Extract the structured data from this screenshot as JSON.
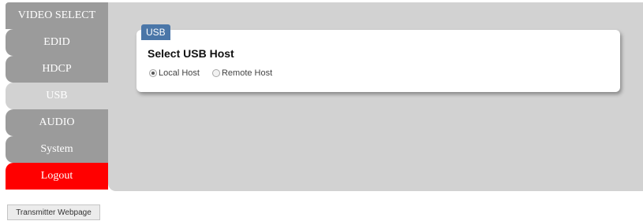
{
  "sidebar": {
    "items": [
      {
        "label": "VIDEO SELECT",
        "active": false
      },
      {
        "label": "EDID",
        "active": false
      },
      {
        "label": "HDCP",
        "active": false
      },
      {
        "label": "USB",
        "active": true
      },
      {
        "label": "AUDIO",
        "active": false
      },
      {
        "label": "System",
        "active": false
      }
    ],
    "logout_label": "Logout"
  },
  "panel": {
    "tag": "USB",
    "title": "Select USB Host",
    "options": [
      {
        "label": "Local Host",
        "checked": true
      },
      {
        "label": "Remote Host",
        "checked": false
      }
    ]
  },
  "footer": {
    "button_label": "Transmitter Webpage"
  },
  "colors": {
    "nav_inactive": "#9b9b9b",
    "nav_active": "#d2d2d2",
    "logout": "#ff0000",
    "tag": "#4a76a8"
  }
}
